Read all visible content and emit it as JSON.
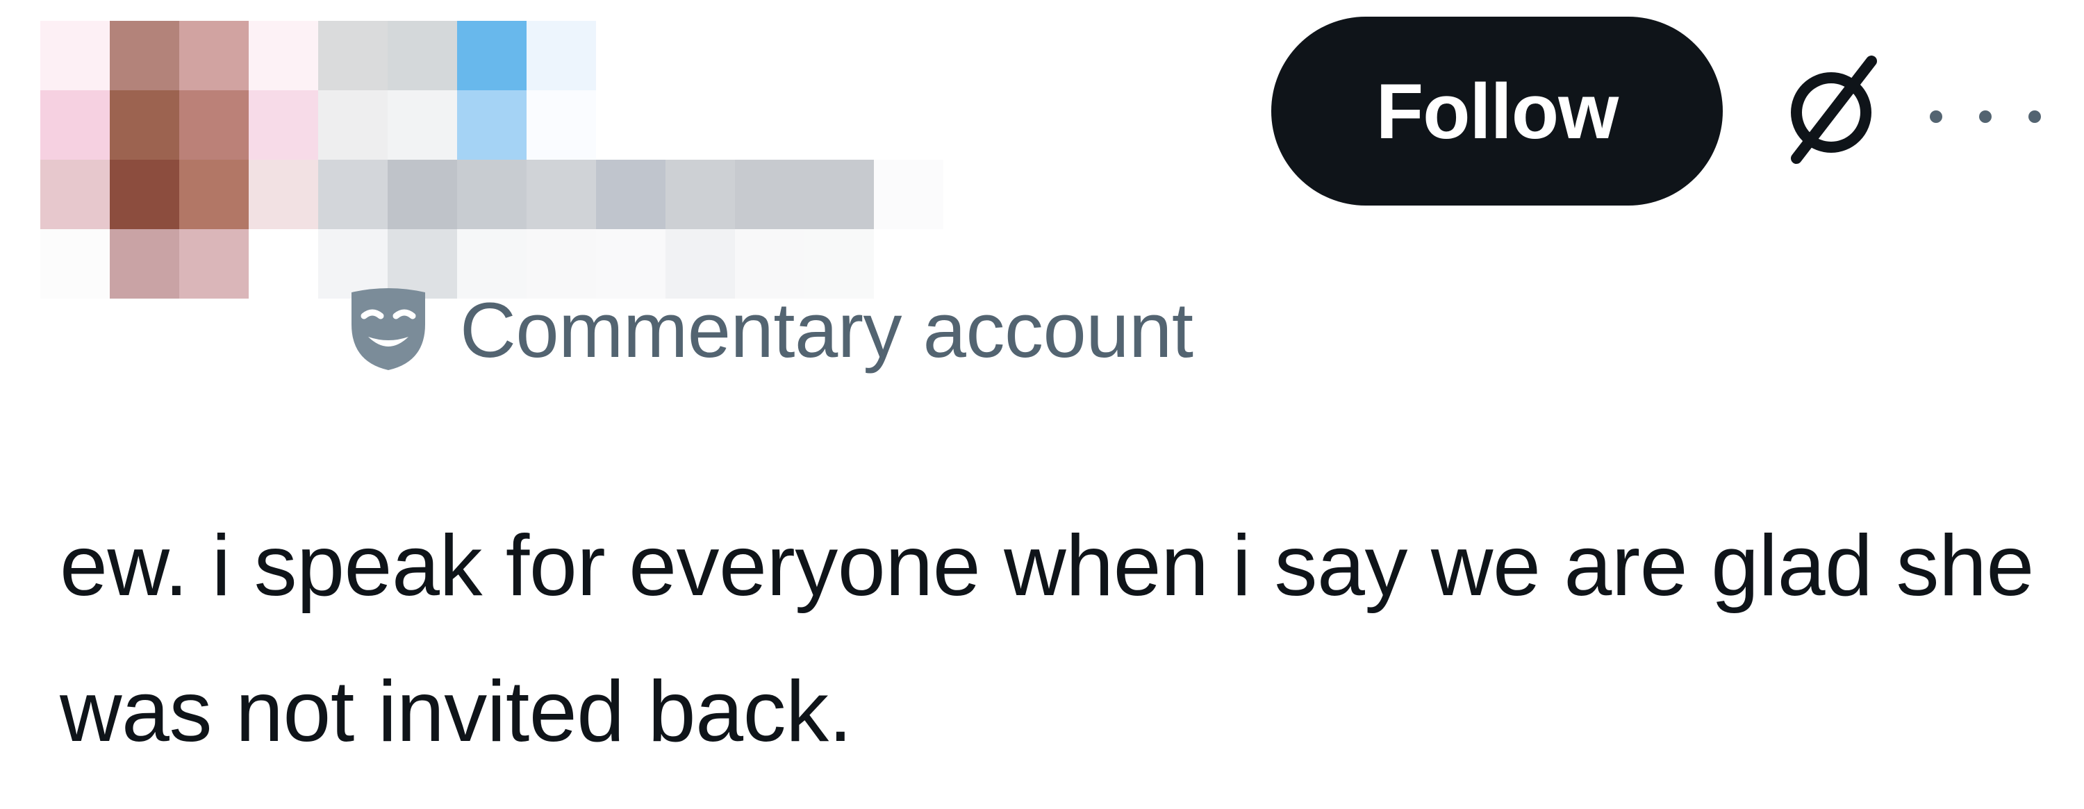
{
  "post": {
    "follow_label": "Follow",
    "grok_icon": "grok-slash-icon",
    "more_icon": "more-dots-icon",
    "account_label": {
      "icon": "theater-mask-icon",
      "text": "Commentary account"
    },
    "text": "ew. i speak for everyone when i say we are glad she was not invited back."
  },
  "colors": {
    "follow_bg": "#0f1419",
    "follow_text": "#ffffff",
    "secondary_text": "#536471",
    "primary_text": "#0f1419"
  }
}
